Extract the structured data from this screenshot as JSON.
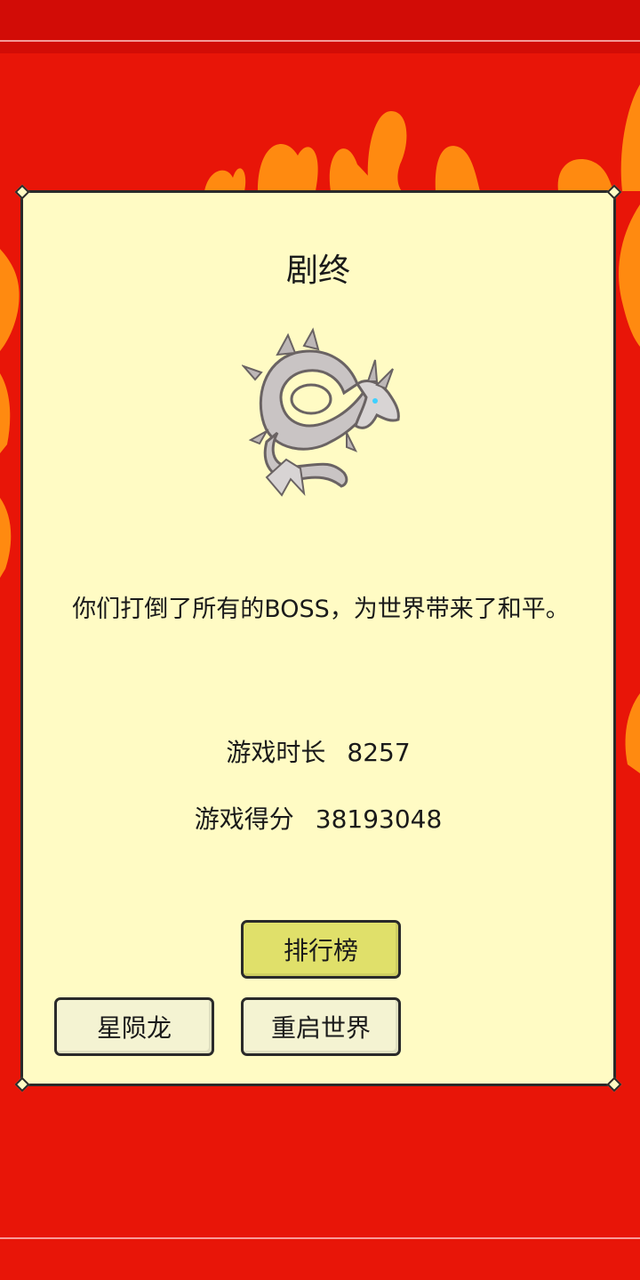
{
  "dialog": {
    "title": "剧终",
    "message": "你们打倒了所有的BOSS，为世界带来了和平。",
    "image_name": "silver-dragon-icon"
  },
  "stats": {
    "playtime_label": "游戏时长",
    "playtime_value": "8257",
    "score_label": "游戏得分",
    "score_value": "38193048"
  },
  "buttons": {
    "leaderboard": "排行榜",
    "dragon": "星陨龙",
    "restart": "重启世界"
  },
  "colors": {
    "background": "#e81508",
    "flame": "#ff8a10",
    "panel": "#fffbc4",
    "leaderboard_button": "#e0e06a",
    "button": "#f4f3d2"
  }
}
